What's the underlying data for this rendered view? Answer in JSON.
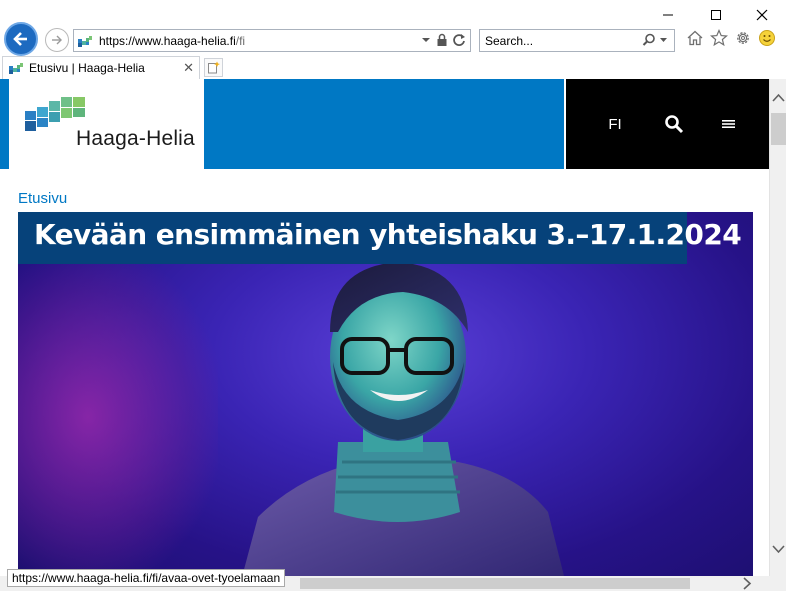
{
  "window": {
    "minimize_icon": "minimize-icon",
    "maximize_icon": "maximize-icon",
    "close_icon": "close-icon"
  },
  "nav": {
    "back_icon": "back-arrow-icon",
    "forward_icon": "forward-arrow-icon",
    "address": {
      "scheme": "https://www.",
      "host": "haaga-helia.fi",
      "path": "/fi",
      "lock_icon": "lock-icon",
      "refresh_icon": "refresh-icon",
      "dropdown_icon": "chevron-down-icon"
    },
    "search": {
      "placeholder": "Search...",
      "search_icon": "search-icon"
    },
    "tools": [
      "home-icon",
      "favorites-star-icon",
      "settings-gear-icon",
      "smiley-feedback-icon"
    ]
  },
  "tabs": [
    {
      "title": "Etusivu | Haaga-Helia",
      "active": true
    }
  ],
  "site": {
    "logo_text": "Haaga-Helia",
    "language": "FI",
    "breadcrumb": "Etusivu",
    "hero_headline": "Kevään ensimmäinen yhteishaku 3.–17.1.2024"
  },
  "status_url": "https://www.haaga-helia.fi/fi/avaa-ovet-tyoelamaan",
  "colors": {
    "brand_blue": "#0078c4",
    "headline_bg": "#06427a",
    "header_black": "#000000"
  }
}
